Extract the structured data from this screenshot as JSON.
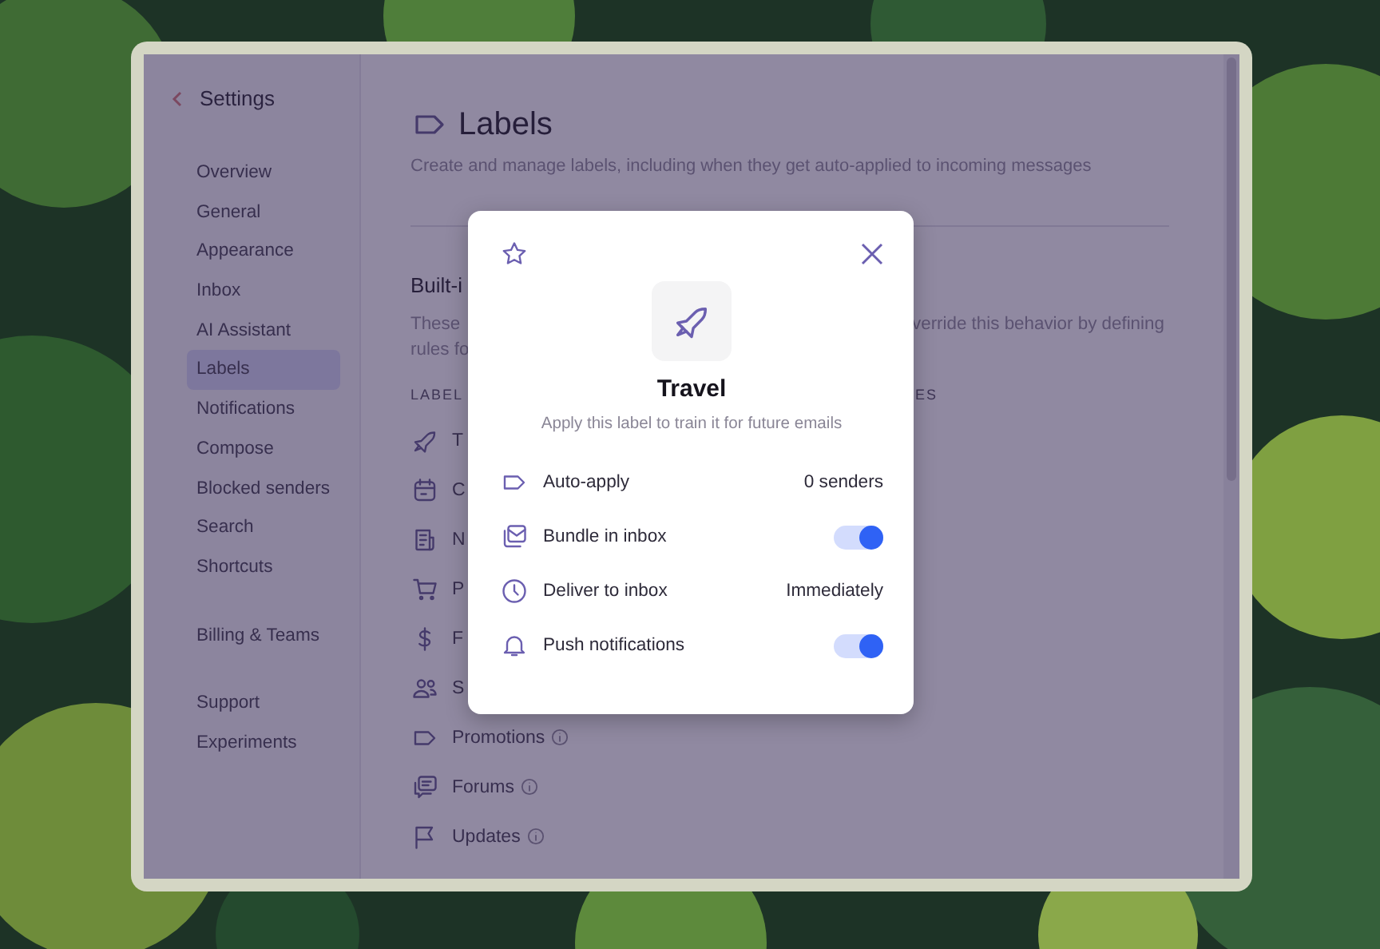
{
  "sidebar": {
    "back_label": "Settings",
    "groups": [
      {
        "items": [
          {
            "label": "Overview",
            "selected": false
          },
          {
            "label": "General",
            "selected": false
          },
          {
            "label": "Appearance",
            "selected": false
          },
          {
            "label": "Inbox",
            "selected": false
          },
          {
            "label": "AI Assistant",
            "selected": false
          },
          {
            "label": "Labels",
            "selected": true
          },
          {
            "label": "Notifications",
            "selected": false
          },
          {
            "label": "Compose",
            "selected": false
          },
          {
            "label": "Blocked senders",
            "selected": false
          },
          {
            "label": "Search",
            "selected": false
          },
          {
            "label": "Shortcuts",
            "selected": false
          }
        ]
      },
      {
        "items": [
          {
            "label": "Billing & Teams",
            "selected": false
          }
        ]
      },
      {
        "items": [
          {
            "label": "Support",
            "selected": false
          },
          {
            "label": "Experiments",
            "selected": false
          }
        ]
      }
    ]
  },
  "content": {
    "title": "Labels",
    "subtitle": "Create and manage labels, including when they get auto-applied to incoming messages",
    "section": {
      "title": "Built-i",
      "description_left": [
        "These",
        "rules fo"
      ],
      "description_right": "verride this behavior by defining",
      "columns": [
        "LABEL",
        "ES"
      ],
      "rows": [
        {
          "name": "T",
          "info": false
        },
        {
          "name": "C",
          "info": false
        },
        {
          "name": "N",
          "info": false
        },
        {
          "name": "P",
          "info": false
        },
        {
          "name": "F",
          "info": false
        },
        {
          "name": "S",
          "info": false
        },
        {
          "name": "Promotions",
          "info": true
        },
        {
          "name": "Forums",
          "info": true
        },
        {
          "name": "Updates",
          "info": true
        }
      ]
    }
  },
  "modal": {
    "title": "Travel",
    "subtitle": "Apply this label to train it for future emails",
    "settings": [
      {
        "kind": "value",
        "label": "Auto-apply",
        "value": "0 senders"
      },
      {
        "kind": "toggle",
        "label": "Bundle in inbox",
        "on": true
      },
      {
        "kind": "value",
        "label": "Deliver to inbox",
        "value": "Immediately"
      },
      {
        "kind": "toggle",
        "label": "Push notifications",
        "on": true
      }
    ]
  }
}
